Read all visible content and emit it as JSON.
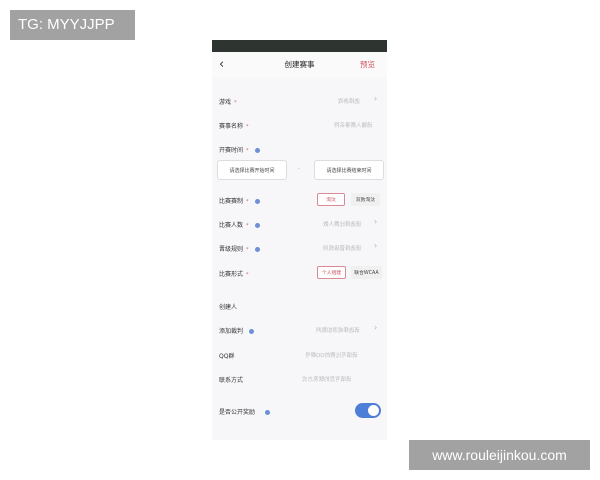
{
  "watermarks": {
    "top_left": "TG: MYYJJPP",
    "bottom_right": "www.rouleijinkou.com"
  },
  "header": {
    "title": "创建赛事",
    "preview": "预览",
    "back_icon": "chevron-left-icon"
  },
  "form": {
    "game": {
      "label": "游戏",
      "placeholder": "选择游戏"
    },
    "name": {
      "label": "赛事名称",
      "placeholder": "请输入赛事名称"
    },
    "start_time": {
      "label": "开赛时间",
      "start_button": "请选择比赛开始时间",
      "separator": "-",
      "end_button": "请选择比赛结束时间"
    },
    "format": {
      "label": "比赛赛制",
      "options": [
        "淘汰",
        "双败淘汰"
      ],
      "selected": "淘汰"
    },
    "players": {
      "label": "比赛人数",
      "placeholder": "请选择比赛人数"
    },
    "advance": {
      "label": "晋级规则",
      "placeholder": "请选择晋级规则"
    },
    "mode": {
      "label": "比赛形式",
      "options": [
        "个人组建",
        "联合WCAA"
      ],
      "selected": "个人组建"
    },
    "creator": {
      "label": "创建人"
    },
    "referee": {
      "label": "添加裁判",
      "placeholder": "请选择或添加裁判"
    },
    "qq": {
      "label": "QQ群",
      "placeholder": "请填写比赛的QQ群号"
    },
    "contact": {
      "label": "联系方式",
      "placeholder": "请填写您的联系方式"
    },
    "public_reward": {
      "label": "是否公开奖励",
      "value": true
    }
  },
  "colors": {
    "accent_red": "#c6505f",
    "toggle_blue": "#4e7fd8",
    "info_dot": "#6d8fd6",
    "statusbar": "#2e3531"
  }
}
